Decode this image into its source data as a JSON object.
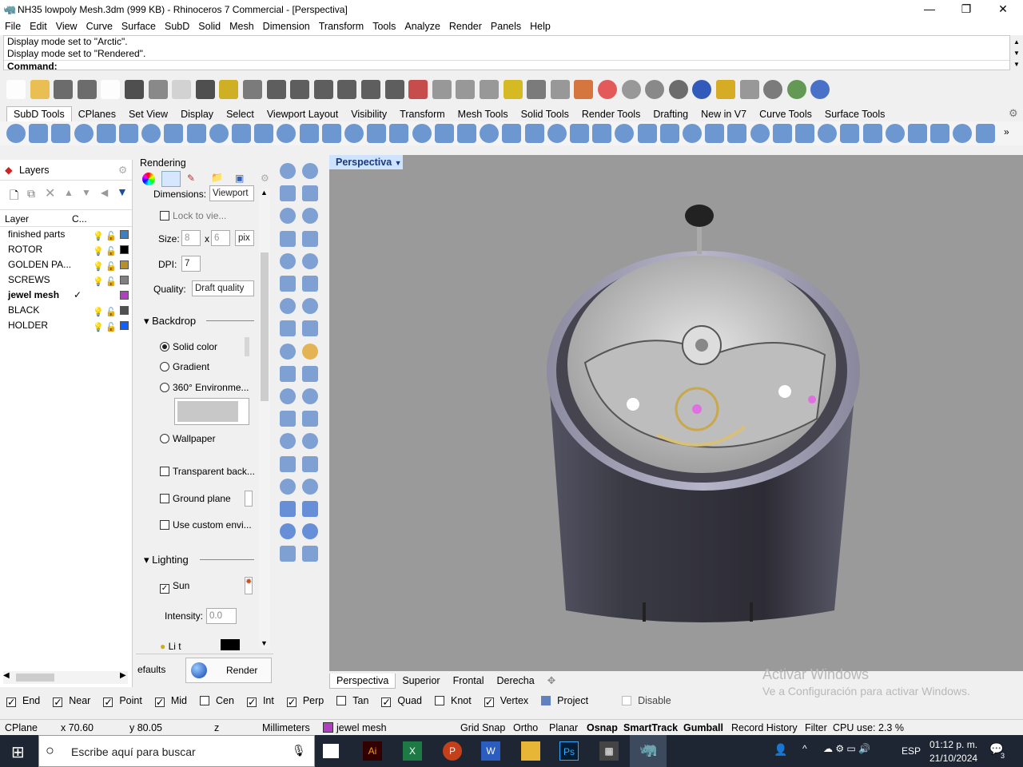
{
  "window": {
    "title": "NH35 lowpoly Mesh.3dm (999 KB) - Rhinoceros 7 Commercial - [Perspectiva]"
  },
  "menu": [
    "File",
    "Edit",
    "View",
    "Curve",
    "Surface",
    "SubD",
    "Solid",
    "Mesh",
    "Dimension",
    "Transform",
    "Tools",
    "Analyze",
    "Render",
    "Panels",
    "Help"
  ],
  "command": {
    "history": [
      "Display mode set to \"Arctic\".",
      "Display mode set to \"Rendered\"."
    ],
    "prompt": "Command:"
  },
  "toolbar_tabs": [
    "SubD Tools",
    "CPlanes",
    "Set View",
    "Display",
    "Select",
    "Viewport Layout",
    "Visibility",
    "Transform",
    "Mesh Tools",
    "Solid Tools",
    "Render Tools",
    "Drafting",
    "New in V7",
    "Curve Tools",
    "Surface Tools"
  ],
  "active_tab": "SubD Tools",
  "layers": {
    "title": "Layers",
    "col_layer": "Layer",
    "col_c": "C...",
    "items": [
      {
        "name": "finished parts",
        "color": "#3b80c0"
      },
      {
        "name": "ROTOR",
        "color": "#000000"
      },
      {
        "name": "GOLDEN PA...",
        "color": "#b8902a"
      },
      {
        "name": "SCREWS",
        "color": "#808080"
      },
      {
        "name": "jewel mesh",
        "color": "#b040c0",
        "current": true
      },
      {
        "name": "BLACK",
        "color": "#505050"
      },
      {
        "name": "HOLDER",
        "color": "#1060ff"
      }
    ]
  },
  "rendering": {
    "title": "Rendering",
    "dimensions_label": "Dimensions:",
    "dimensions_value": "Viewport",
    "lock": "Lock to vie...",
    "size_label": "Size:",
    "size_w": "8",
    "size_x": "x",
    "size_h": "6",
    "size_unit": "pix",
    "dpi_label": "DPI:",
    "dpi_value": "7",
    "quality_label": "Quality:",
    "quality_value": "Draft quality",
    "backdrop": "Backdrop",
    "solid_color": "Solid color",
    "gradient": "Gradient",
    "env360": "360° Environme...",
    "wallpaper": "Wallpaper",
    "transparent": "Transparent back...",
    "ground_plane": "Ground plane",
    "custom_env": "Use custom envi...",
    "lighting": "Lighting",
    "sun": "Sun",
    "intensity_label": "Intensity:",
    "intensity_value": "0.0",
    "skylight": "Li  t light:",
    "defaults": "efaults",
    "render": "Render"
  },
  "viewport": {
    "name": "Perspectiva",
    "tabs": [
      "Perspectiva",
      "Superior",
      "Frontal",
      "Derecha"
    ]
  },
  "watermark": {
    "line1": "Activar Windows",
    "line2": "Ve a Configuración para activar Windows."
  },
  "osnap": [
    {
      "label": "End",
      "on": true
    },
    {
      "label": "Near",
      "on": true
    },
    {
      "label": "Point",
      "on": true
    },
    {
      "label": "Mid",
      "on": true
    },
    {
      "label": "Cen",
      "on": false
    },
    {
      "label": "Int",
      "on": true
    },
    {
      "label": "Perp",
      "on": true
    },
    {
      "label": "Tan",
      "on": false
    },
    {
      "label": "Quad",
      "on": true
    },
    {
      "label": "Knot",
      "on": false
    },
    {
      "label": "Vertex",
      "on": true
    },
    {
      "label": "Project",
      "on": false
    },
    {
      "label": "Disable",
      "on": false
    }
  ],
  "status": {
    "cplane": "CPlane",
    "x": "x 70.60",
    "y": "y 80.05",
    "z": "z",
    "units": "Millimeters",
    "layer": "jewel mesh",
    "grid_snap": "Grid Snap",
    "ortho": "Ortho",
    "planar": "Planar",
    "osnap": "Osnap",
    "smarttrack": "SmartTrack",
    "gumball": "Gumball",
    "record": "Record History",
    "filter": "Filter",
    "cpu": "CPU use: 2.3 %"
  },
  "taskbar": {
    "search_placeholder": "Escribe aquí para buscar",
    "lang": "ESP",
    "time": "01:12 p. m.",
    "date": "21/10/2024",
    "notif": "3"
  }
}
